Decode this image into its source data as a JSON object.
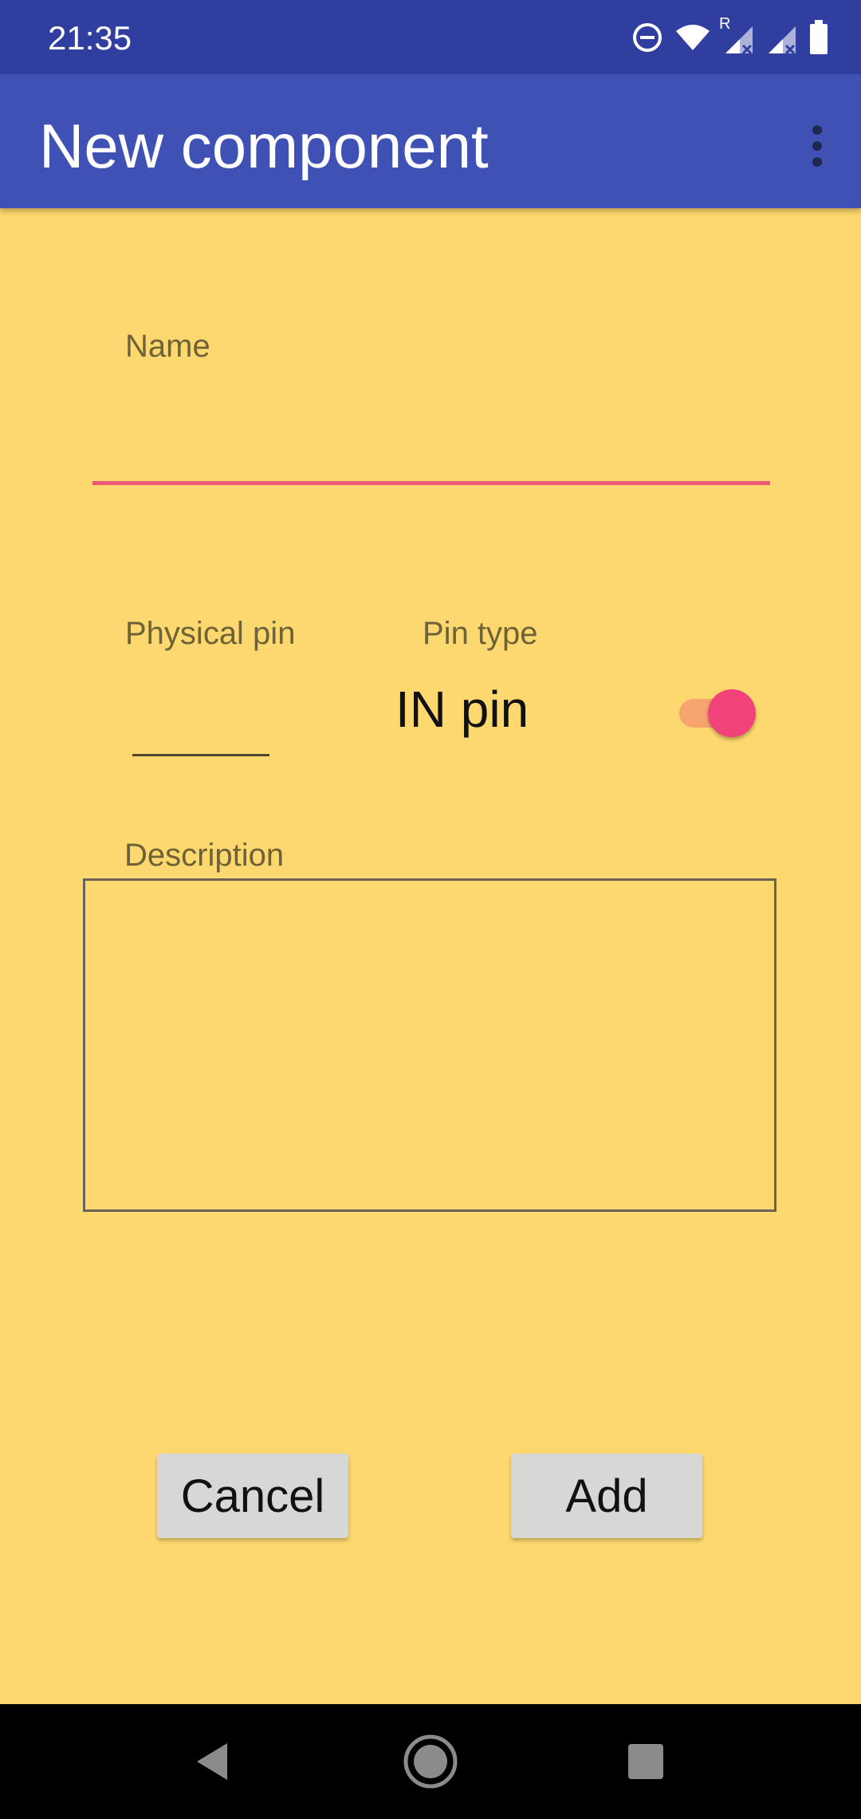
{
  "status_bar": {
    "time": "21:35",
    "icons": [
      "do-not-disturb-icon",
      "wifi-icon",
      "signal-roaming-icon",
      "signal-icon",
      "battery-icon"
    ],
    "roaming_letter": "R"
  },
  "app_bar": {
    "title": "New component",
    "menu_icon": "more-vert-icon"
  },
  "form": {
    "name": {
      "label": "Name",
      "value": ""
    },
    "physical_pin": {
      "label": "Physical pin",
      "value": ""
    },
    "pin_type": {
      "label": "Pin type",
      "value": "IN pin",
      "toggle_on": true
    },
    "description": {
      "label": "Description",
      "value": ""
    }
  },
  "actions": {
    "cancel_label": "Cancel",
    "add_label": "Add"
  },
  "nav_bar": {
    "icons": [
      "back-icon",
      "home-icon",
      "recents-icon"
    ]
  },
  "colors": {
    "status_bar": "#303F9F",
    "app_bar": "#3F51B5",
    "background": "#FDD86E",
    "accent": "#F2427A",
    "button": "#D7D7D5"
  }
}
